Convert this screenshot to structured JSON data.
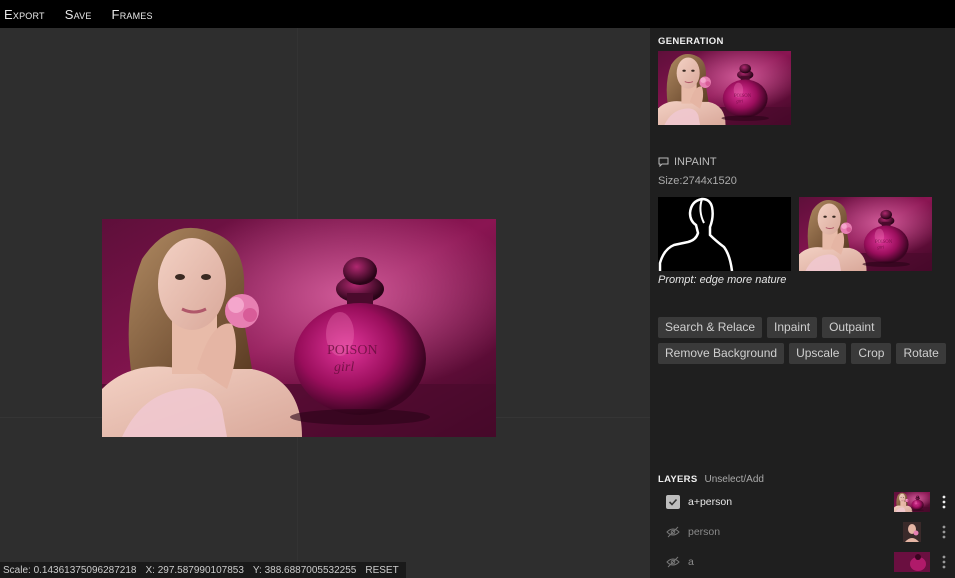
{
  "menu": {
    "export": "Export",
    "save": "Save",
    "frames": "Frames"
  },
  "status": {
    "scale": "Scale: 0.14361375096287218",
    "x": "X: 297.587990107853",
    "y": "Y: 388.6887005532255",
    "reset": "RESET"
  },
  "panel": {
    "generation_title": "GENERATION",
    "inpaint_label": "INPAINT",
    "size": "Size:2744x1520",
    "prompt": "Prompt: edge more nature",
    "tools_row1": [
      "Search & Relace",
      "Inpaint",
      "Outpaint"
    ],
    "tools_row2": [
      "Remove Background",
      "Upscale",
      "Crop",
      "Rotate"
    ]
  },
  "layers": {
    "title": "LAYERS",
    "action": "Unselect/Add",
    "items": [
      {
        "name": "a+person",
        "visible": true
      },
      {
        "name": "person",
        "visible": false
      },
      {
        "name": "a",
        "visible": false
      }
    ]
  },
  "colors": {
    "menubar": "#000000",
    "canvas": "#2e2e2e",
    "panel": "#1f1f1f",
    "button": "#3a3a3a",
    "magenta": "#a0155c"
  }
}
